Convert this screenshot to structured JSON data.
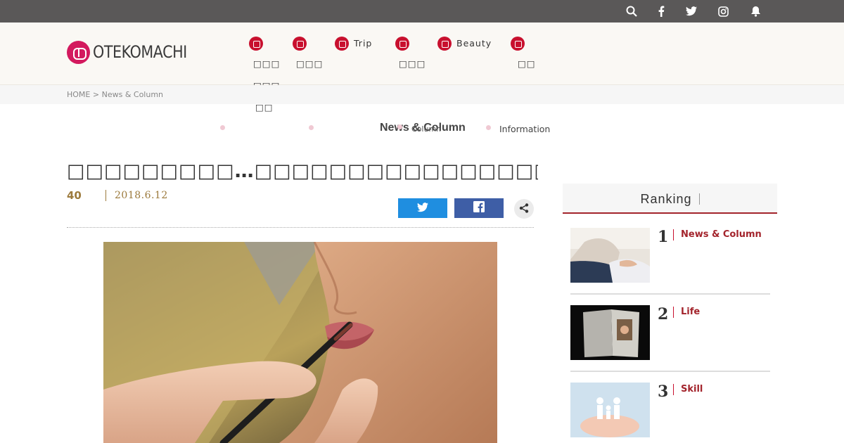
{
  "topbar": {
    "icons": [
      "search-icon",
      "facebook-icon",
      "twitter-icon",
      "instagram-icon",
      "bell-icon"
    ]
  },
  "header": {
    "logo_text": "OTEKOMACHI",
    "nav": [
      {
        "icon": "news-icon",
        "label": "□□□",
        "sub1": "□□□",
        "sub2": "□□"
      },
      {
        "icon": "pen-icon",
        "label": "□□□"
      },
      {
        "icon": "trip-icon",
        "label": "Trip"
      },
      {
        "icon": "food-icon",
        "label": "□□□"
      },
      {
        "icon": "beauty-icon",
        "label": "Beauty"
      },
      {
        "icon": "pin-icon",
        "label": "□□"
      }
    ]
  },
  "breadcrumb": {
    "home": "HOME",
    "sep": ">",
    "current": "News & Column"
  },
  "subnav": {
    "category_title": "News & Column",
    "items": [
      "",
      "",
      "Column",
      "Information"
    ]
  },
  "article": {
    "headline": "□□□□□□□□□…□□□□□□□□□□□□□□□□□□",
    "count": "40",
    "date": "2018.6.12",
    "share_icons": [
      "twitter-icon",
      "facebook-icon",
      "share-icon"
    ]
  },
  "ranking": {
    "title": "Ranking",
    "items": [
      {
        "rank": "1",
        "category": "News & Column"
      },
      {
        "rank": "2",
        "category": "Life"
      },
      {
        "rank": "3",
        "category": "Skill"
      }
    ]
  },
  "colors": {
    "topbar": "#5a5858",
    "brand": "#d3195e",
    "accent": "#a3242c",
    "twitter": "#1f8ee0",
    "facebook": "#3e5ea6",
    "meta": "#9c7a3c"
  }
}
